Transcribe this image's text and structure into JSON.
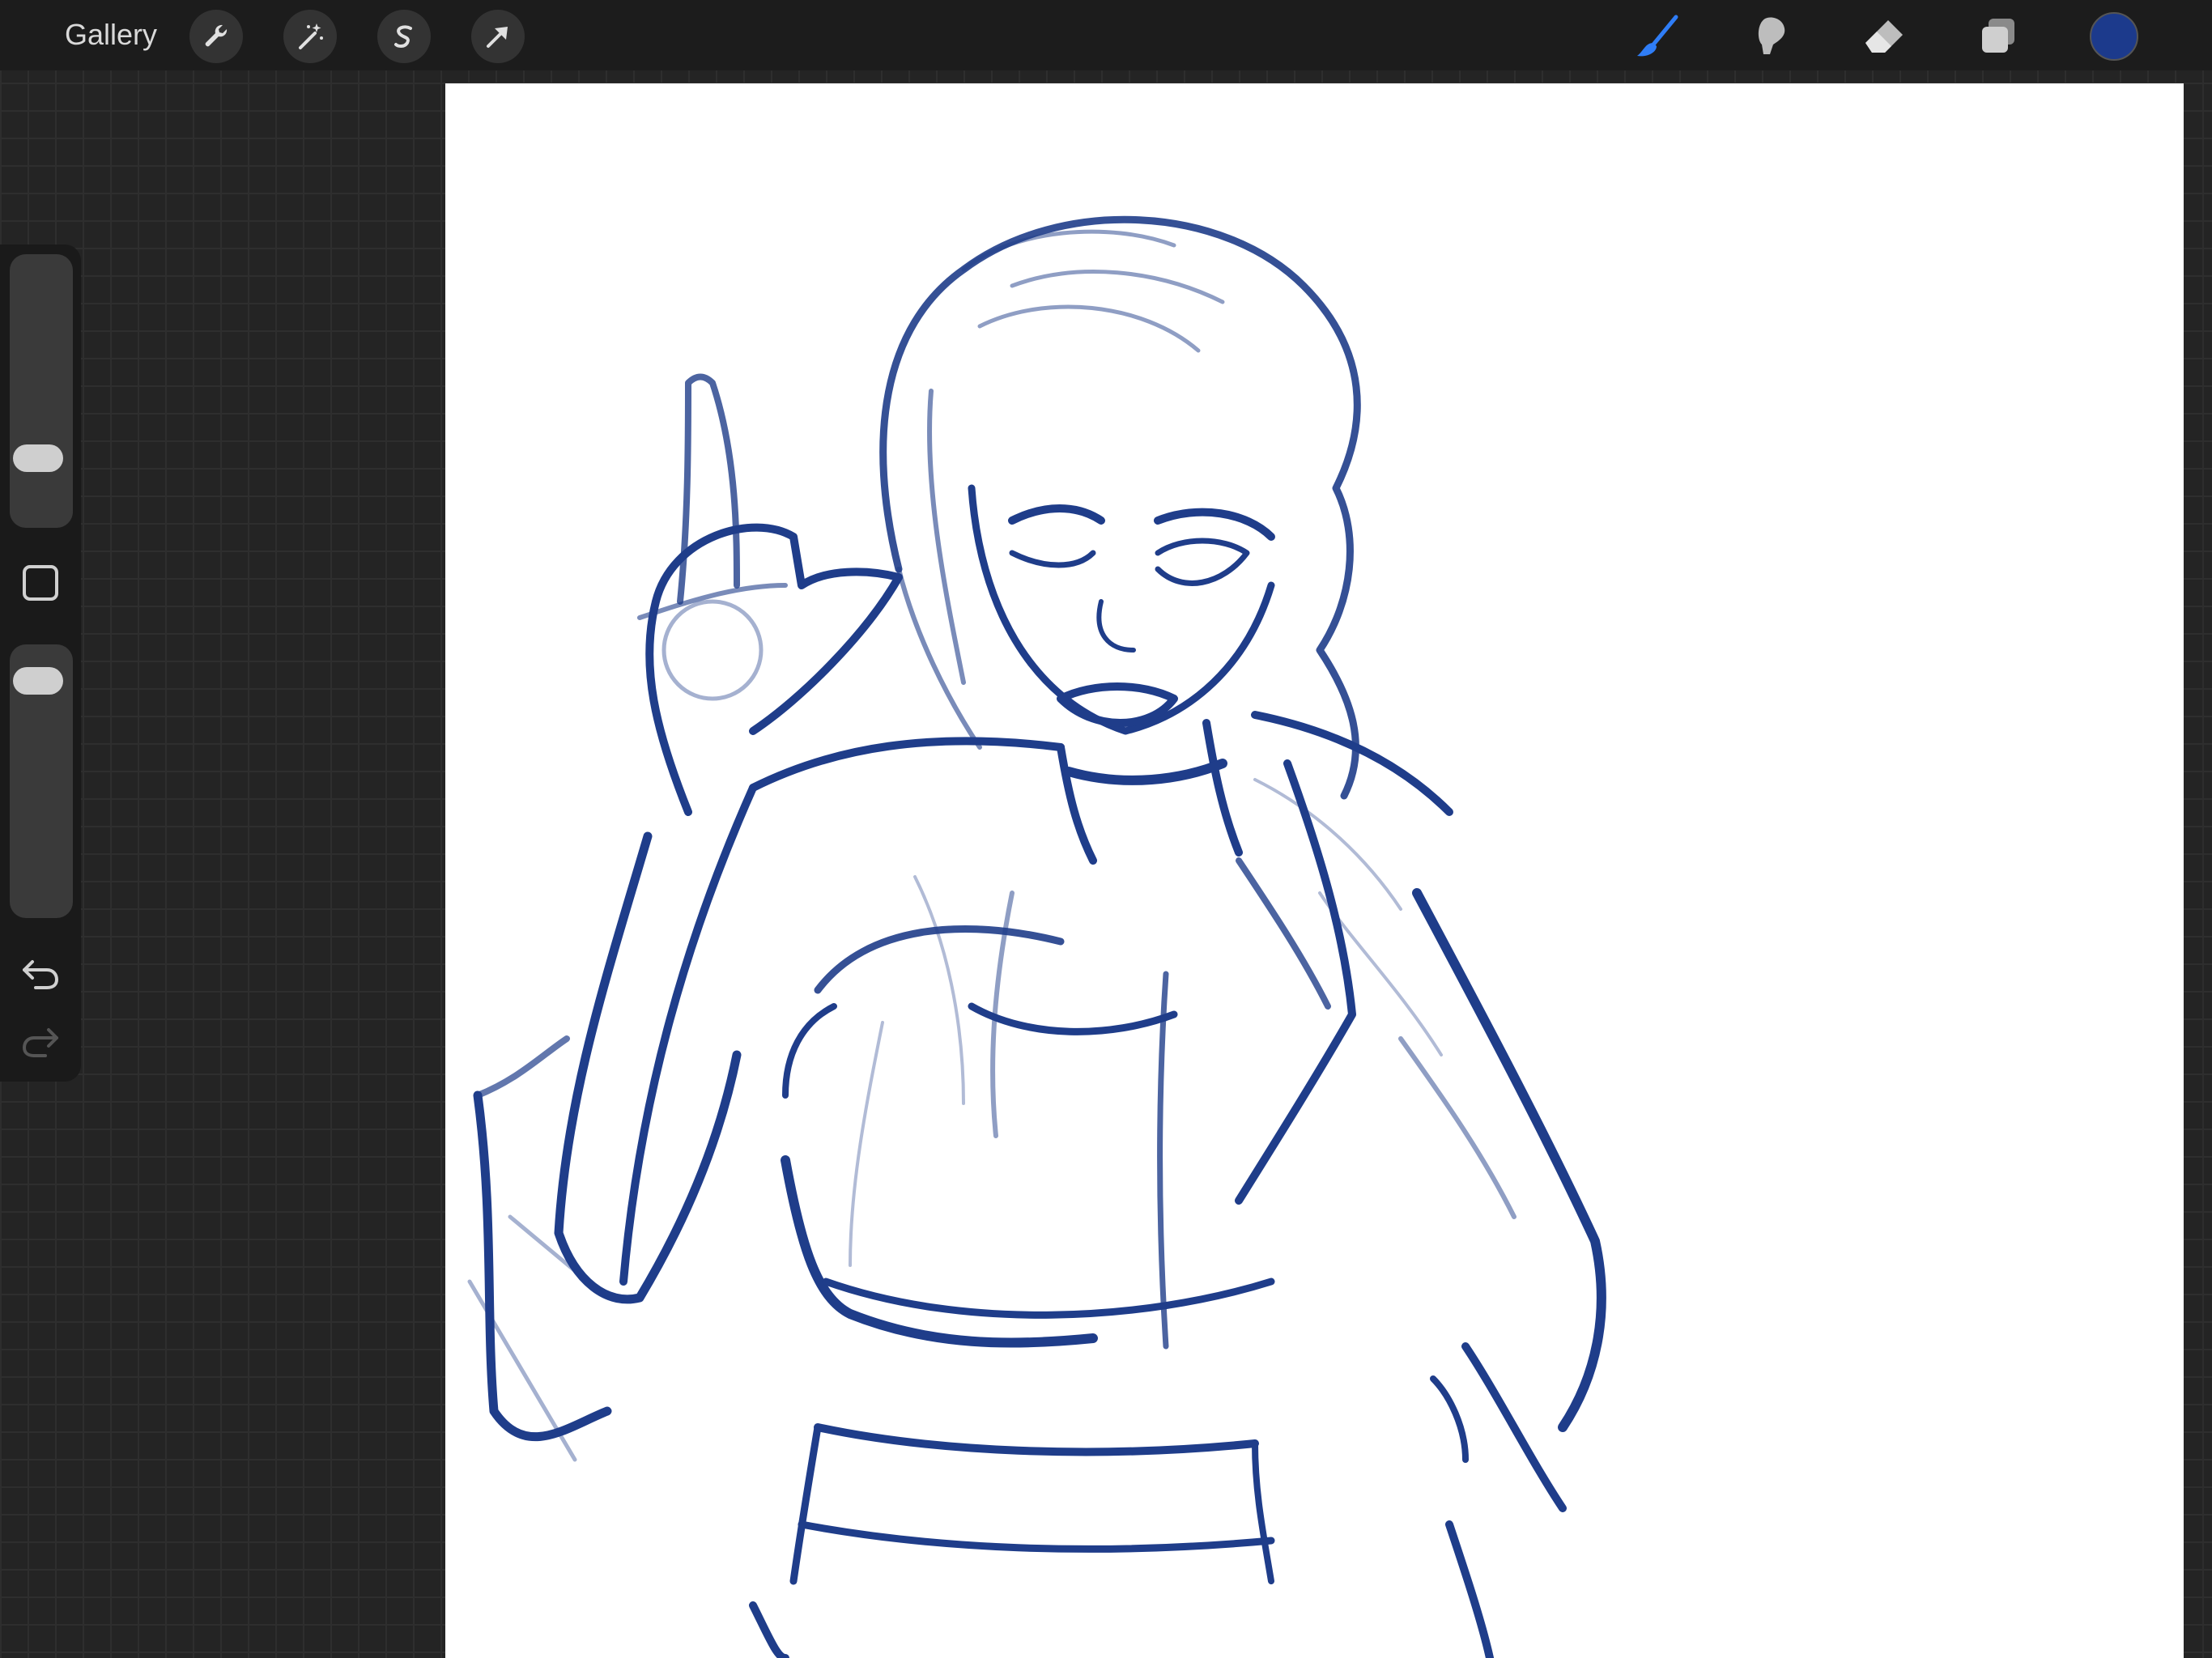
{
  "toolbar": {
    "gallery_label": "Gallery",
    "left_tools": [
      {
        "name": "actions",
        "icon": "wrench-icon"
      },
      {
        "name": "adjustments",
        "icon": "magic-wand-icon"
      },
      {
        "name": "selection",
        "icon": "selection-s-icon"
      },
      {
        "name": "transform",
        "icon": "arrow-cursor-icon"
      }
    ],
    "right_tools": [
      {
        "name": "brush",
        "icon": "brush-icon",
        "active": true
      },
      {
        "name": "smudge",
        "icon": "smudge-icon"
      },
      {
        "name": "eraser",
        "icon": "eraser-icon"
      },
      {
        "name": "layers",
        "icon": "layers-icon"
      }
    ],
    "current_color": "#1c3a8c",
    "active_tool_color": "#2f7df6"
  },
  "sidebar": {
    "brush_size_level": 0.22,
    "opacity_level": 0.92
  },
  "canvas": {
    "stroke_color": "#1f3d8a",
    "background": "#ffffff"
  }
}
